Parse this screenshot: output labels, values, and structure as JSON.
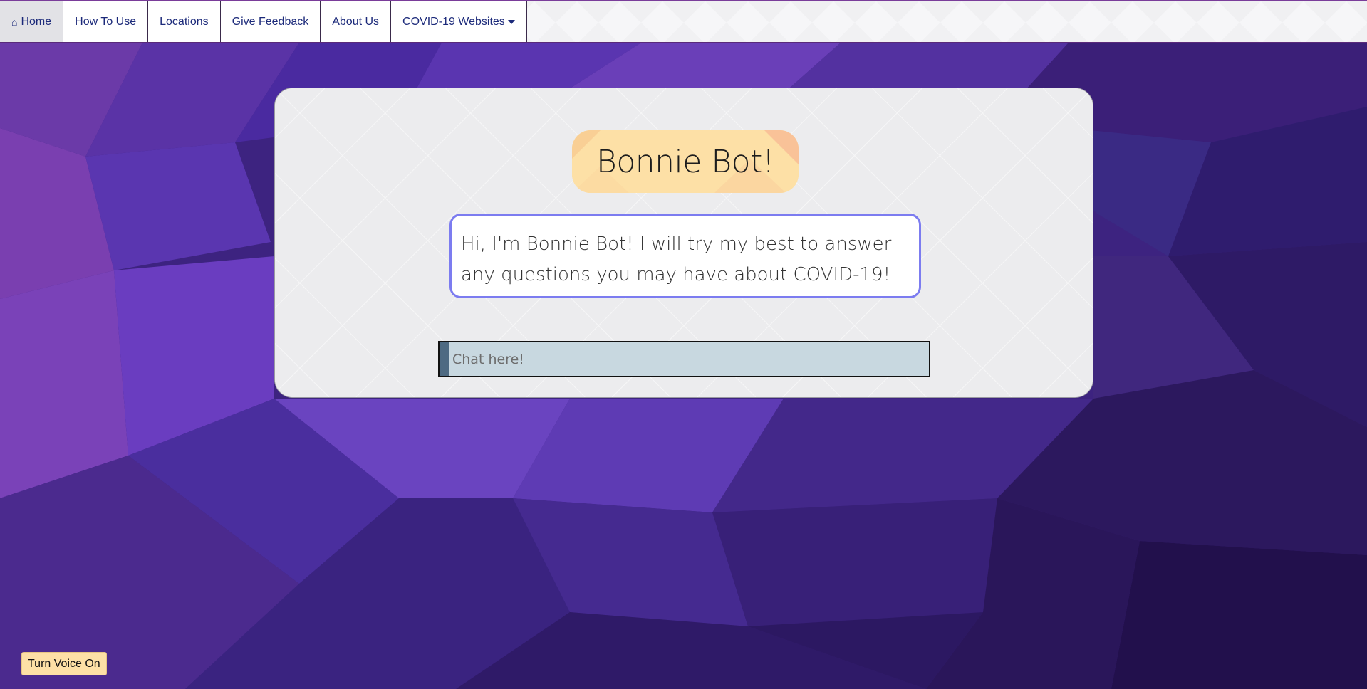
{
  "nav": {
    "home": "Home",
    "how_to_use": "How To Use",
    "locations": "Locations",
    "give_feedback": "Give Feedback",
    "about_us": "About Us",
    "covid_websites": "COVID-19 Websites"
  },
  "bot": {
    "title": "Bonnie Bot!",
    "greeting": "Hi, I'm Bonnie Bot! I will try my best to answer any questions you may have about COVID-19!"
  },
  "chat": {
    "placeholder": "Chat here!"
  },
  "voice_button": "Turn Voice On",
  "colors": {
    "background_purple": "#3f2580",
    "title_pill": "#fde0a6",
    "bubble_border": "#7c7cf0",
    "input_fill": "#c8d8e0",
    "nav_link": "#1c2a7a"
  }
}
